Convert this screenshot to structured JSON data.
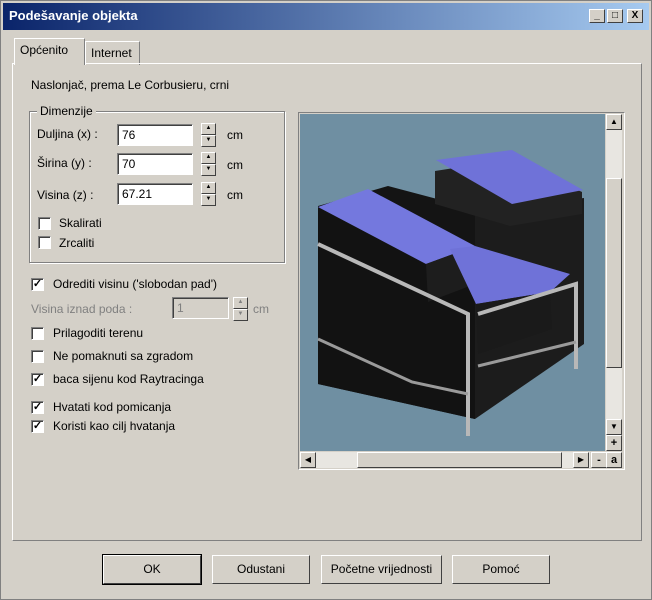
{
  "window": {
    "title": "Podešavanje objekta"
  },
  "titlebar_buttons": {
    "minimize": "_",
    "maximize": "□",
    "close": "X"
  },
  "tabs": [
    {
      "label": "Općenito",
      "active": true
    },
    {
      "label": "Internet",
      "active": false
    }
  ],
  "description": "Naslonjač, prema Le Corbusieru, crni",
  "dimensions": {
    "title": "Dimenzije",
    "unit": "cm",
    "fields": [
      {
        "label": "Duljina (x) :",
        "value": "76"
      },
      {
        "label": "Širina (y) :",
        "value": "70"
      },
      {
        "label": "Visina (z) :",
        "value": "67.21"
      }
    ],
    "scale_label": "Skalirati",
    "mirror_label": "Zrcaliti"
  },
  "options": {
    "free_fall": {
      "label": "Odrediti visinu ('slobodan pad')",
      "checked": true
    },
    "height_above_floor": {
      "label": "Visina iznad poda :",
      "value": "1",
      "unit": "cm"
    },
    "terrain": {
      "label": "Prilagoditi terenu",
      "checked": false
    },
    "no_move_building": {
      "label": "Ne pomaknuti sa zgradom",
      "checked": false
    },
    "raytracing_shadow": {
      "label": "baca sijenu kod Raytracinga",
      "checked": true
    },
    "snap_move": {
      "label": "Hvatati kod pomicanja",
      "checked": true
    },
    "snap_target": {
      "label": "Koristi kao cilj hvatanja",
      "checked": true
    }
  },
  "preview": {
    "zoom_in": "+",
    "zoom_out": "-",
    "zoom_auto": "a"
  },
  "buttons": {
    "ok": "OK",
    "cancel": "Odustani",
    "defaults": "Početne vrijednosti",
    "help": "Pomoć"
  }
}
